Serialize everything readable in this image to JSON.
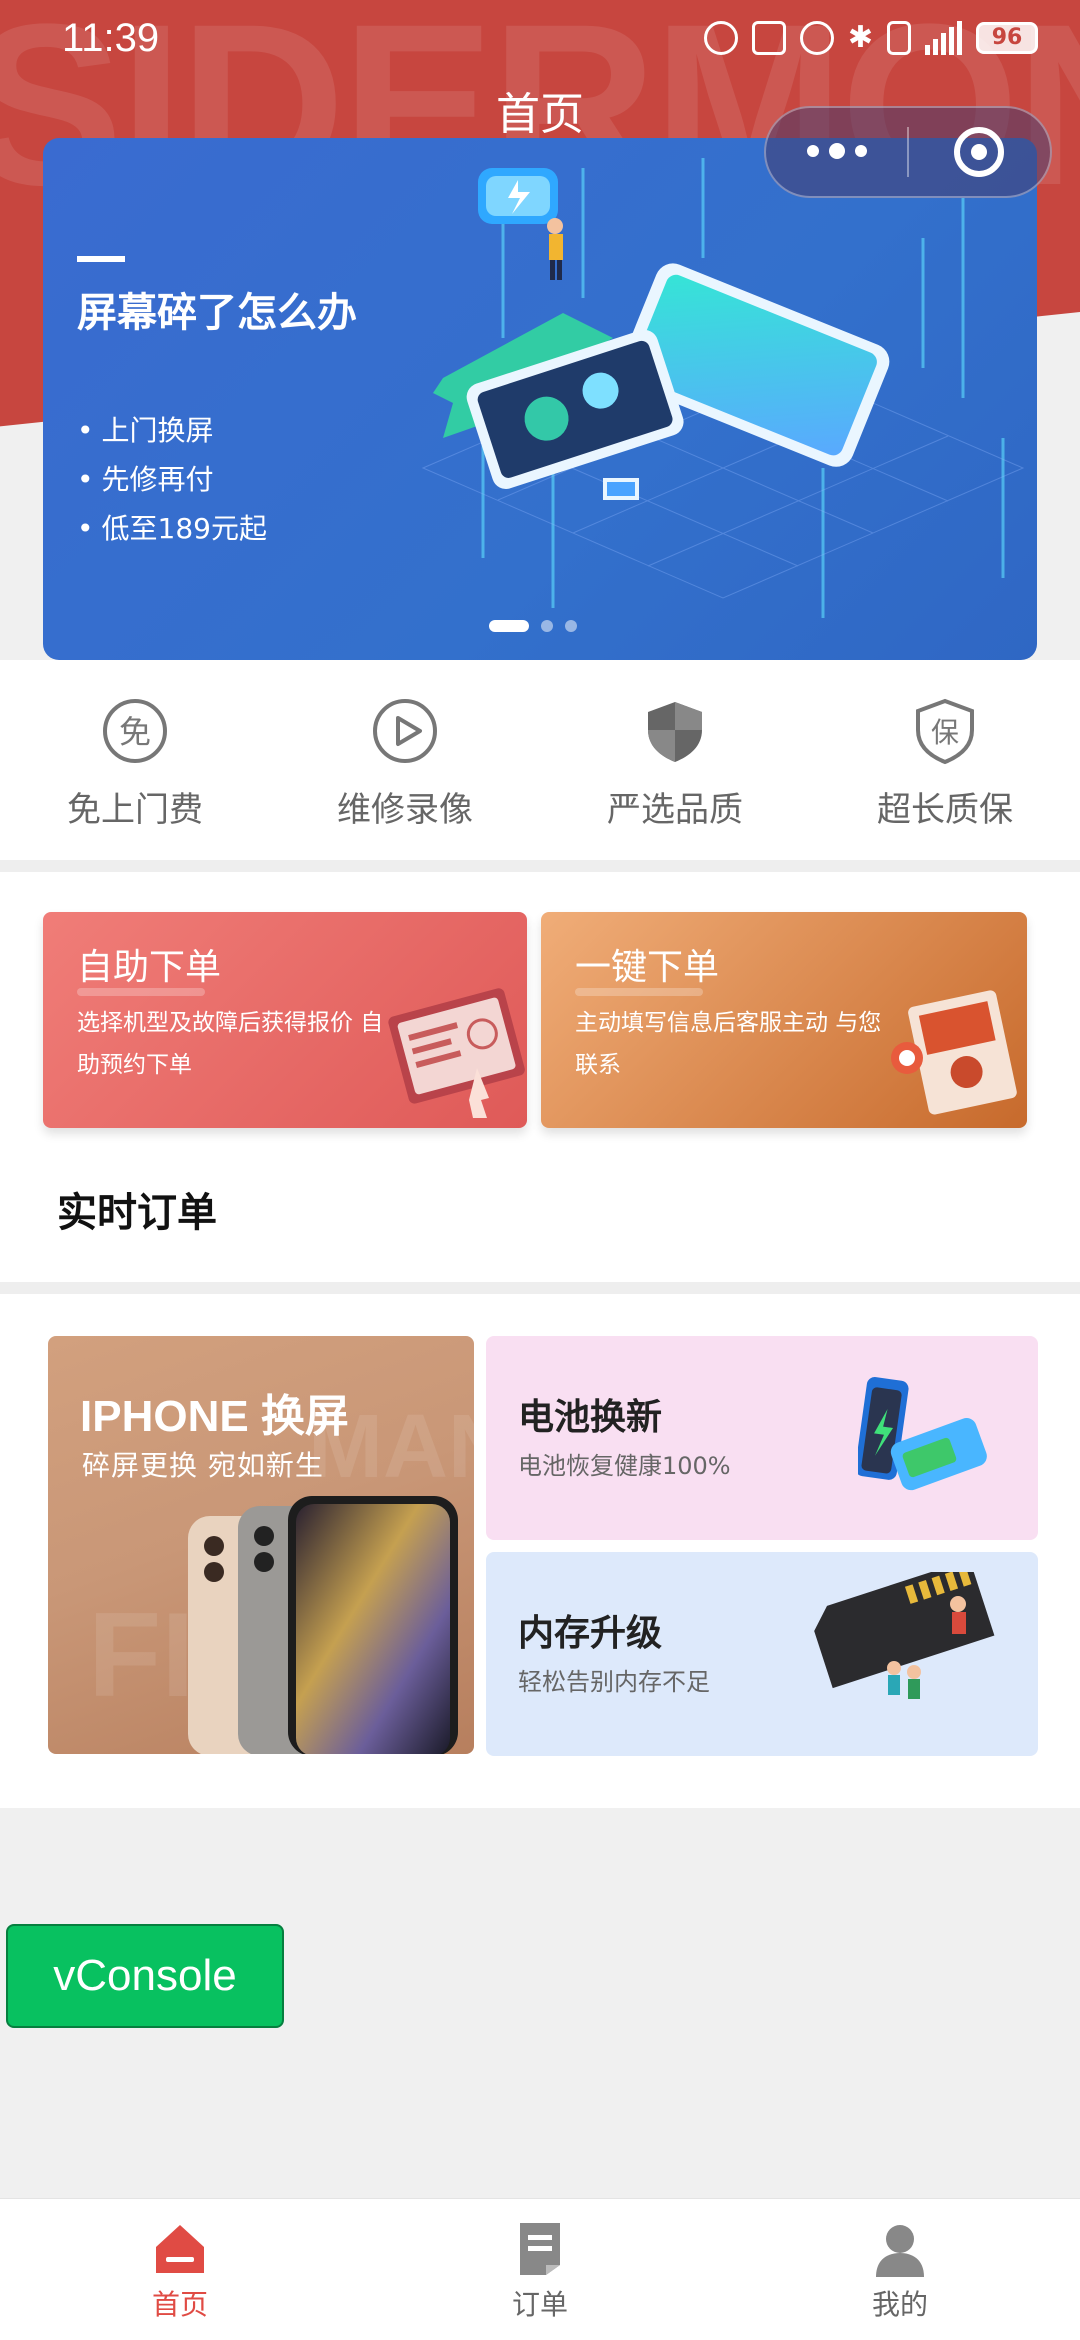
{
  "status_bar": {
    "time": "11:39",
    "battery": "96"
  },
  "header": {
    "title": "首页",
    "watermark": "SIDERMONEY"
  },
  "banner": {
    "title": "屏幕碎了怎么办",
    "points": [
      "上门换屏",
      "先修再付",
      "低至189元起"
    ],
    "slide_count": 3,
    "active_slide": 0
  },
  "features": [
    {
      "label": "免上门费",
      "icon": "free-badge-icon"
    },
    {
      "label": "维修录像",
      "icon": "play-circle-icon"
    },
    {
      "label": "严选品质",
      "icon": "shield-icon"
    },
    {
      "label": "超长质保",
      "icon": "warranty-shield-icon"
    }
  ],
  "order_cards": {
    "self_service": {
      "title": "自助下单",
      "desc": "选择机型及故障后获得报价 自助预约下单"
    },
    "one_click": {
      "title": "一键下单",
      "desc": "主动填写信息后客服主动 与您联系"
    }
  },
  "realtime_orders": {
    "title": "实时订单"
  },
  "promos": {
    "iphone": {
      "title": "IPHONE 换屏",
      "subtitle": "碎屏更换   宛如新生",
      "watermark_1": "FIX",
      "watermark_2": "MAN"
    },
    "battery": {
      "title": "电池换新",
      "subtitle": "电池恢复健康100%"
    },
    "memory": {
      "title": "内存升级",
      "subtitle": "轻松告别内存不足"
    }
  },
  "vconsole": {
    "label": "vConsole"
  },
  "tabbar": {
    "tabs": [
      {
        "label": "首页",
        "icon": "home-icon",
        "active": true
      },
      {
        "label": "订单",
        "icon": "order-doc-icon",
        "active": false
      },
      {
        "label": "我的",
        "icon": "user-icon",
        "active": false
      }
    ]
  },
  "colors": {
    "brand_red": "#c7463f",
    "banner_blue": "#3370cc",
    "active_tab": "#e04b44",
    "vconsole_green": "#08c160"
  }
}
